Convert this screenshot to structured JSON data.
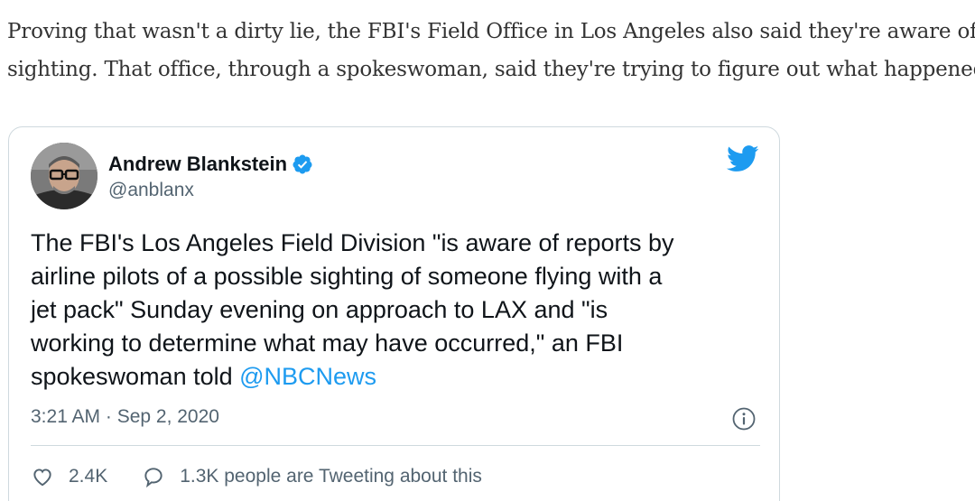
{
  "article": {
    "paragraph_lines": [
      "Proving that wasn't a dirty lie, the FBI's Field Office in Los Angeles also said they're aware of the",
      "sighting. That office, through a spokeswoman, said they're trying to figure out what happened."
    ]
  },
  "tweet": {
    "author_name": "Andrew Blankstein",
    "handle": "@anblanx",
    "body_lines": [
      "The FBI's Los Angeles Field Division \"is aware of reports by",
      "airline pilots of a possible sighting of someone flying with a",
      "jet pack\" Sunday evening on approach to LAX and \"is",
      "working to determine what may have occurred,\" an FBI",
      "spokeswoman told "
    ],
    "mention": "@NBCNews",
    "timestamp": "3:21 AM · Sep 2, 2020",
    "likes": "2.4K",
    "conversation": "1.3K people are Tweeting about this",
    "icons": {
      "verified": "verified-badge-icon",
      "brand": "twitter-bird-icon",
      "info": "info-icon",
      "like": "heart-icon",
      "reply": "speech-bubble-icon"
    },
    "colors": {
      "accent": "#1d9bf0",
      "secondary_text": "#536471",
      "border": "#cfd9de"
    }
  }
}
